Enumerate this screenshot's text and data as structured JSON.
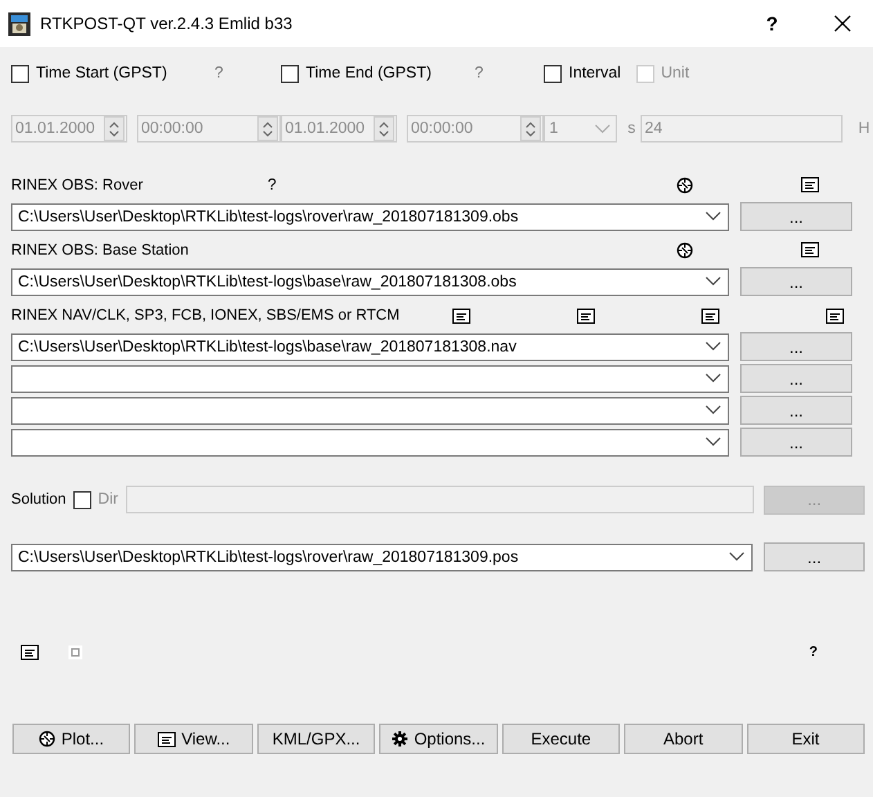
{
  "window": {
    "title": "RTKPOST-QT ver.2.4.3 Emlid b33",
    "help": "?"
  },
  "time_start": {
    "label": "Time Start (GPST)",
    "checked": false,
    "hint": "?",
    "date": "01.01.2000",
    "time": "00:00:00"
  },
  "time_end": {
    "label": "Time End (GPST)",
    "checked": false,
    "hint": "?",
    "date": "01.01.2000",
    "time": "00:00:00"
  },
  "interval": {
    "label": "Interval",
    "checked": false,
    "unit_label": "Unit",
    "unit_checked": false,
    "value": "1",
    "value_unit": "s",
    "unit_value": "24",
    "unit_suffix": "H"
  },
  "inputs": [
    {
      "kind": "obs",
      "label": "RINEX OBS: Rover",
      "hint": "?",
      "rows": [
        {
          "value": "C:\\Users\\User\\Desktop\\RTKLib\\test-logs\\rover\\raw_201807181309.obs",
          "browse": "..."
        }
      ]
    },
    {
      "kind": "obs",
      "label": "RINEX OBS: Base Station",
      "rows": [
        {
          "value": "C:\\Users\\User\\Desktop\\RTKLib\\test-logs\\base\\raw_201807181308.obs",
          "browse": "..."
        }
      ]
    },
    {
      "kind": "nav",
      "label": "RINEX NAV/CLK, SP3, FCB, IONEX, SBS/EMS  or RTCM",
      "rows": [
        {
          "value": "C:\\Users\\User\\Desktop\\RTKLib\\test-logs\\base\\raw_201807181308.nav",
          "browse": "..."
        },
        {
          "browse": "..."
        },
        {
          "browse": "..."
        },
        {
          "browse": "..."
        }
      ]
    }
  ],
  "solution": {
    "label": "Solution",
    "dir_checked": false,
    "dir_label": "Dir",
    "browse": "..."
  },
  "output": {
    "value": "C:\\Users\\User\\Desktop\\RTKLib\\test-logs\\rover\\raw_201807181309.pos",
    "browse": "..."
  },
  "footer": {
    "hint": "?"
  },
  "buttons": [
    {
      "label": "Plot..."
    },
    {
      "label": "View..."
    },
    {
      "label": "KML/GPX..."
    },
    {
      "label": "Options..."
    },
    {
      "label": "Execute"
    },
    {
      "label": "Abort"
    },
    {
      "label": "Exit"
    }
  ]
}
